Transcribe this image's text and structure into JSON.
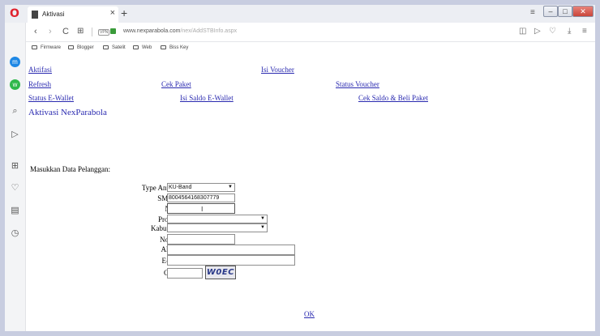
{
  "browser": {
    "tab_title": "Aktivasi",
    "tab_close": "×",
    "new_tab": "+",
    "url_domain": "www.nexparabola.com",
    "url_path": "/nex/AddSTBInfo.aspx",
    "vpn_label": "VPN",
    "bookmarks": [
      "Firmware",
      "Blogger",
      "Satelit",
      "Web",
      "Biss Key"
    ]
  },
  "nav_links": {
    "aktifasi": "Aktifasi",
    "isi_voucher": "Isi Voucher",
    "refresh": "Refresh",
    "cek_paket": "Cek Paket",
    "status_voucher": "Status Voucher",
    "status_ewallet": "Status E-Wallet",
    "isi_saldo": "Isi Saldo E-Wallet",
    "cek_saldo": "Cek Saldo & Beli Paket"
  },
  "page": {
    "heading": "Aktivasi NexParabola",
    "intro": "Masukkan Data Pelanggan:",
    "ok": "OK"
  },
  "form": {
    "type_antenna": {
      "label": "Type Antenna",
      "value": "KU-Band"
    },
    "smc_id": {
      "label": "SMC ID",
      "value": "8004564168307779"
    },
    "nama": {
      "label": "Nama",
      "value": ""
    },
    "provinsi": {
      "label": "Provinsi",
      "value": ""
    },
    "kabupaten": {
      "label": "Kabupaten",
      "value": ""
    },
    "no_tlp": {
      "label": "No. Tlp",
      "value": ""
    },
    "alamat": {
      "label": "Alamat",
      "value": ""
    },
    "email": {
      "label": "E-Mail",
      "value": ""
    },
    "check": {
      "label": "Check",
      "value": "",
      "captcha": "W0EC"
    }
  },
  "icons": {
    "opera": "O",
    "back": "‹",
    "forward": "›",
    "reload": "C",
    "grid": "⊞",
    "camera": "◫",
    "send": "▷",
    "heart": "♡",
    "download": "⤓",
    "menu": "≡",
    "search": "⌕",
    "player": "▷",
    "speed_dial": "⊞",
    "news": "▤",
    "history": "◷",
    "messenger": "m",
    "whatsapp": "w",
    "text_cursor": "I",
    "select_arrow": "▼"
  },
  "colors": {
    "link": "#2a2ab0",
    "opera_red": "#e0232e",
    "frame_bg": "#c8cde0"
  }
}
